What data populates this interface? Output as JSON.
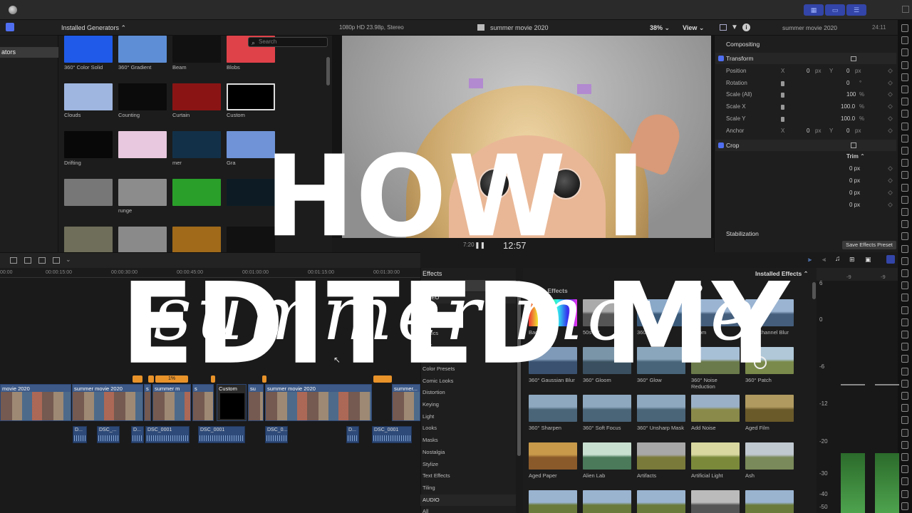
{
  "toolbar": {
    "window_buttons": [
      "▦",
      "▭",
      "☰"
    ]
  },
  "browser": {
    "title": "Installed Generators ⌃",
    "sidebar_selected": "ators",
    "search_placeholder": "Search",
    "tiles": [
      {
        "label": "360° Color Solid",
        "color": "#1f5be8"
      },
      {
        "label": "360° Gradient",
        "color": "#5e8fd6"
      },
      {
        "label": "Beam",
        "color": "#111111"
      },
      {
        "label": "Blobs",
        "color": "#e0424a"
      },
      {
        "label": "Clouds",
        "color": "#9fb6e0"
      },
      {
        "label": "Counting",
        "color": "#0b0b0b"
      },
      {
        "label": "Curtain",
        "color": "#8a1414"
      },
      {
        "label": "Custom",
        "color": "#000000"
      },
      {
        "label": "Drifting",
        "color": "#080808"
      },
      {
        "label": "",
        "color": "#e8c8de"
      },
      {
        "label": "mer",
        "color": "#123048"
      },
      {
        "label": "Gra",
        "color": "#6f93d6"
      },
      {
        "label": "",
        "color": "#777777"
      },
      {
        "label": "runge",
        "color": "#8c8c8c"
      },
      {
        "label": "",
        "color": "#2aa02a"
      },
      {
        "label": "",
        "color": "#0d1c24"
      },
      {
        "label": "",
        "color": "#6e6e5a"
      },
      {
        "label": "",
        "color": "#8a8a8a"
      },
      {
        "label": "",
        "color": "#a06a1a"
      },
      {
        "label": "",
        "color": "#111111"
      }
    ]
  },
  "viewer": {
    "format": "1080p HD 23.98p, Stereo",
    "title": "summer movie 2020",
    "zoom": "38% ⌄",
    "view": "View ⌄",
    "timecode": "12:57",
    "timecode_right": "7:20"
  },
  "inspector": {
    "title": "summer movie 2020",
    "duration": "24:11",
    "compositing": "Compositing",
    "transform": "Transform",
    "rows": [
      {
        "label": "Position",
        "x_label": "X",
        "x": "0",
        "x_unit": "px",
        "y_label": "Y",
        "y": "0",
        "y_unit": "px"
      },
      {
        "label": "Rotation",
        "value": "0",
        "unit": "°"
      },
      {
        "label": "Scale (All)",
        "value": "100",
        "unit": "%"
      },
      {
        "label": "Scale X",
        "value": "100.0",
        "unit": "%"
      },
      {
        "label": "Scale Y",
        "value": "100.0",
        "unit": "%"
      },
      {
        "label": "Anchor",
        "x_label": "X",
        "x": "0",
        "x_unit": "px",
        "y_label": "Y",
        "y": "0",
        "y_unit": "px"
      }
    ],
    "crop": "Crop",
    "trim": "Trim ⌃",
    "crop_values": [
      "0 px",
      "0 px",
      "0 px",
      "0 px"
    ],
    "stabilization": "Stabilization",
    "save_preset": "Save Effects Preset"
  },
  "timeline": {
    "ruler": [
      "00:00",
      "00:00:15:00",
      "00:00:30:00",
      "00:00:45:00",
      "00:01:00:00",
      "00:01:15:00",
      "00:01:30:00"
    ],
    "clips": [
      "movie 2020",
      "summer movie 2020",
      "s",
      "summer m",
      "s",
      "Custom",
      "su",
      "summer movie 2020",
      "summer..."
    ],
    "audio": [
      "D...",
      "DSC_...",
      "D...",
      "DSC_0001",
      "DSC_0001",
      "DSC_0...",
      "D...",
      "DSC_0001"
    ],
    "marker_label": "1%"
  },
  "effects": {
    "title": "Effects",
    "installed": "Installed Effects ⌃",
    "section": "Video Effects",
    "list": [
      "All Video & Audio",
      "VIDEO",
      "All",
      "360°",
      "Basics",
      "Blur",
      "Color",
      "Color Presets",
      "Comic Looks",
      "Distortion",
      "Keying",
      "Light",
      "Looks",
      "Masks",
      "Nostalgia",
      "Stylize",
      "Text Effects",
      "Tiling",
      "AUDIO",
      "All"
    ],
    "tiles": [
      {
        "label": "Bad TV...",
        "c1": "#e33",
        "c2": "#33c"
      },
      {
        "label": "50s TV",
        "c1": "#aaa",
        "c2": "#555"
      },
      {
        "label": "360° Aura",
        "c1": "#8aa8c8",
        "c2": "#3b5a7a"
      },
      {
        "label": "Bloom",
        "c1": "#9ab4d2",
        "c2": "#445e7c"
      },
      {
        "label": "360° Channel Blur",
        "c1": "#9ab4d2",
        "c2": "#445e7c"
      },
      {
        "label": "360° Gaussian Blur",
        "c1": "#7f9ab8",
        "c2": "#3a5270"
      },
      {
        "label": "360° Gloom",
        "c1": "#7a94a8",
        "c2": "#3a5060"
      },
      {
        "label": "360° Glow",
        "c1": "#8aa6bc",
        "c2": "#476478"
      },
      {
        "label": "360° Noise Reduction",
        "c1": "#a8c0d6",
        "c2": "#6b7a4a"
      },
      {
        "label": "360° Patch",
        "c1": "#b0c8d8",
        "c2": "#7a8a4a"
      },
      {
        "label": "360° Sharpen",
        "c1": "#8ea8c0",
        "c2": "#4a6478"
      },
      {
        "label": "360° Soft Focus",
        "c1": "#8ea8c0",
        "c2": "#4a6478"
      },
      {
        "label": "360° Unsharp Mask",
        "c1": "#8ea8c0",
        "c2": "#4a6478"
      },
      {
        "label": "Add Noise",
        "c1": "#9ab0c6",
        "c2": "#8a8a4a"
      },
      {
        "label": "Aged Film",
        "c1": "#b09a60",
        "c2": "#6a5a2a"
      },
      {
        "label": "Aged Paper",
        "c1": "#c89a4a",
        "c2": "#8a5a2a"
      },
      {
        "label": "Alien Lab",
        "c1": "#c8e0d0",
        "c2": "#4a7a5a"
      },
      {
        "label": "Artifacts",
        "c1": "#a8a8a8",
        "c2": "#7a7a3a"
      },
      {
        "label": "Artificial Light",
        "c1": "#d8d8a0",
        "c2": "#7a8a3a"
      },
      {
        "label": "Ash",
        "c1": "#c0c8d0",
        "c2": "#7a8a5a"
      },
      {
        "label": "",
        "c1": "#9ab4d0",
        "c2": "#6a7a3a"
      },
      {
        "label": "",
        "c1": "#9ab4d0",
        "c2": "#6a7a3a"
      },
      {
        "label": "",
        "c1": "#9ab4d0",
        "c2": "#6a7a3a"
      },
      {
        "label": "",
        "c1": "#bbbbbb",
        "c2": "#555555"
      },
      {
        "label": "",
        "c1": "#9ab4d0",
        "c2": "#6a7a3a"
      }
    ]
  },
  "meters": {
    "ticks": [
      "6",
      "0",
      "-6",
      "-12",
      "-20",
      "-30",
      "-40",
      "-50"
    ],
    "top_labels": [
      "-9",
      "-9"
    ]
  },
  "overlay": {
    "title": "HOW I EDITED MY",
    "script": "summer movie"
  }
}
